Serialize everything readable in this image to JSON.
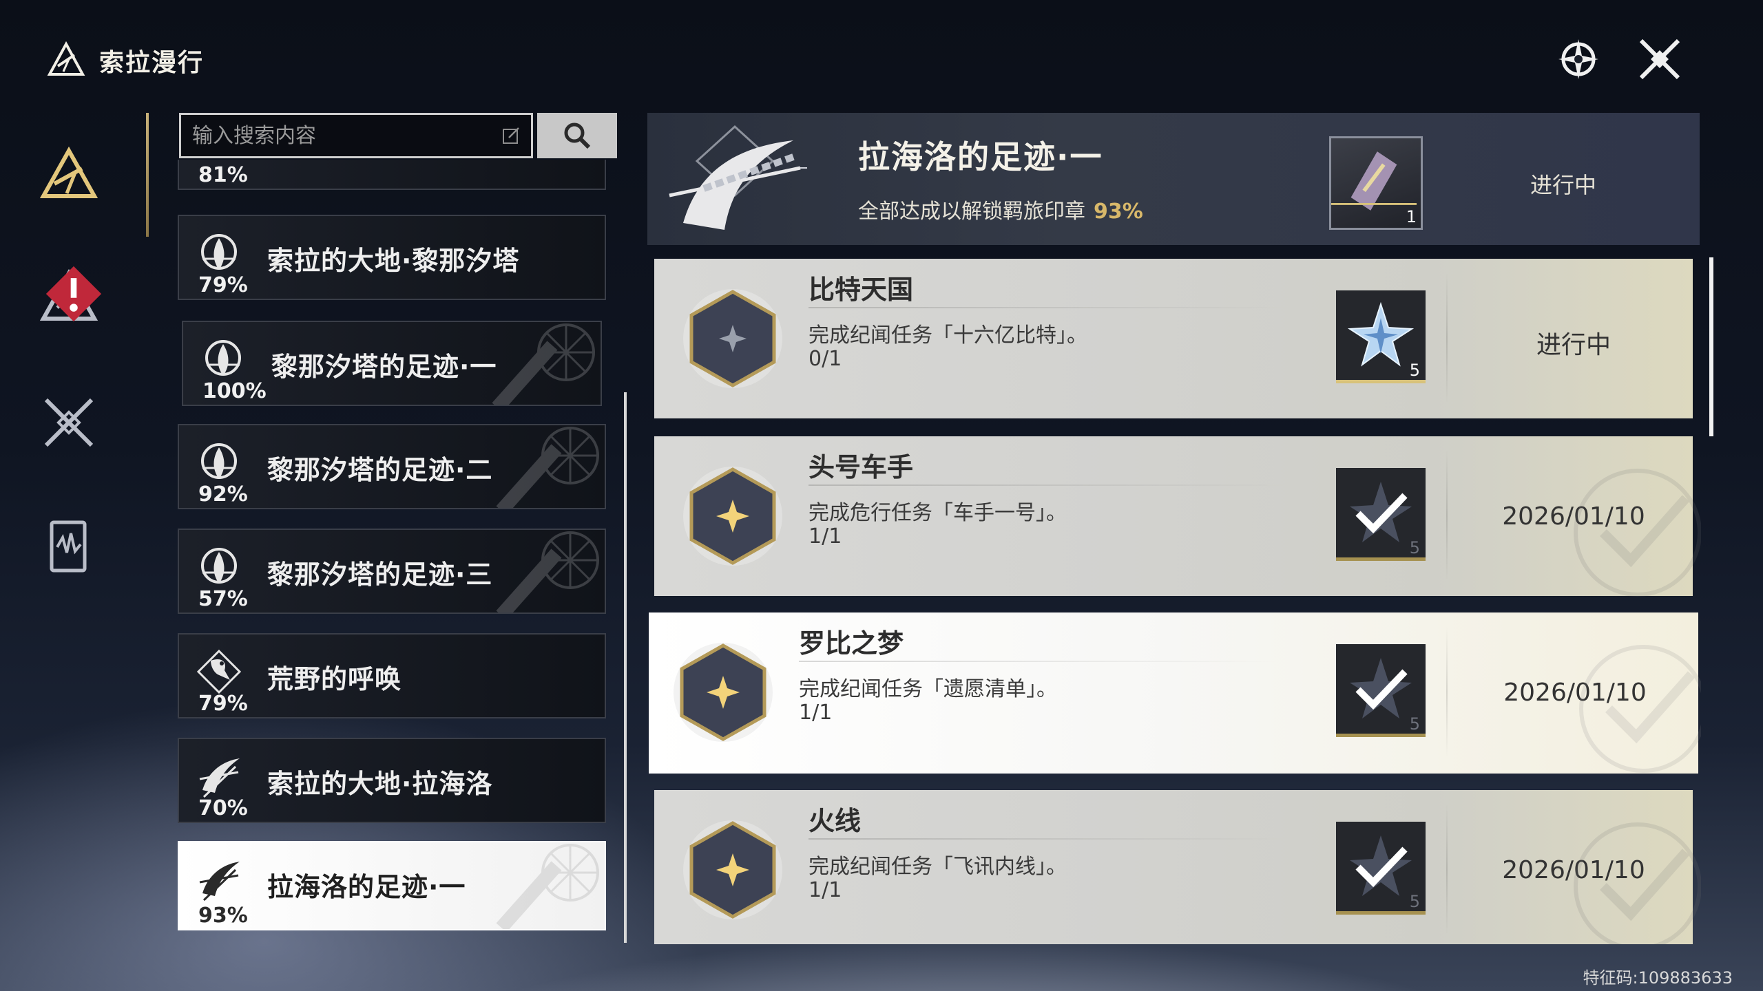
{
  "app": {
    "title": "索拉漫行"
  },
  "search": {
    "placeholder": "输入搜索内容"
  },
  "sidebar": {
    "items": [
      {
        "icon": "triangle-emblem-icon",
        "active": true
      },
      {
        "icon": "mountain-emblem-icon",
        "alert": true
      },
      {
        "icon": "crossed-swords-icon"
      },
      {
        "icon": "card-deck-icon"
      }
    ]
  },
  "regions": [
    {
      "name": "",
      "percent": "81%"
    },
    {
      "name": "索拉的大地·黎那汐塔",
      "percent": "79%"
    },
    {
      "name": "黎那汐塔的足迹·一",
      "percent": "100%"
    },
    {
      "name": "黎那汐塔的足迹·二",
      "percent": "92%"
    },
    {
      "name": "黎那汐塔的足迹·三",
      "percent": "57%"
    },
    {
      "name": "荒野的呼唤",
      "percent": "79%"
    },
    {
      "name": "索拉的大地·拉海洛",
      "percent": "70%"
    },
    {
      "name": "拉海洛的足迹·一",
      "percent": "93%",
      "selected": true
    }
  ],
  "header": {
    "title": "拉海洛的足迹·一",
    "subtitle": "全部达成以解锁羁旅印章",
    "percent": "93%",
    "reward_count": "1",
    "status": "进行中"
  },
  "achievements": [
    {
      "name": "比特天国",
      "desc": "完成纪闻任务「十六亿比特」。",
      "progress": "0/1",
      "reward_count": "5",
      "status": "进行中",
      "done": false
    },
    {
      "name": "头号车手",
      "desc": "完成危行任务「车手一号」。",
      "progress": "1/1",
      "reward_count": "5",
      "status": "2026/01/10",
      "done": true
    },
    {
      "name": "罗比之梦",
      "desc": "完成纪闻任务「遗愿清单」。",
      "progress": "1/1",
      "reward_count": "5",
      "status": "2026/01/10",
      "done": true
    },
    {
      "name": "火线",
      "desc": "完成纪闻任务「飞讯内线」。",
      "progress": "1/1",
      "reward_count": "5",
      "status": "2026/01/10",
      "done": true
    }
  ],
  "footer": {
    "feature_code": "特征码:109883633"
  },
  "colors": {
    "accent_gold": "#d8b86a",
    "alert_red": "#c0283a"
  }
}
